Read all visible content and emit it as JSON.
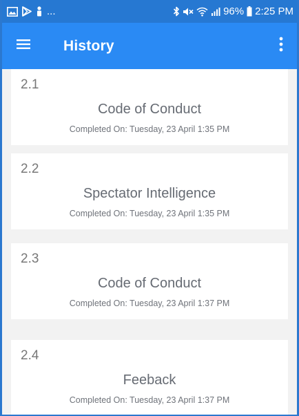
{
  "status_bar": {
    "notification_icons": [
      "image-icon",
      "play-store-icon",
      "person-icon"
    ],
    "more_text": "...",
    "right_icons": [
      "bluetooth-icon",
      "mute-icon",
      "wifi-icon",
      "signal-icon"
    ],
    "battery": "96%",
    "time": "2:25 PM"
  },
  "app_bar": {
    "title": "History",
    "menu_icon": "hamburger-menu-icon",
    "overflow_icon": "more-vertical-icon"
  },
  "history": [
    {
      "number": "2.1",
      "title": "Code of Conduct",
      "completed": "Completed On: Tuesday, 23 April 1:35 PM"
    },
    {
      "number": "2.2",
      "title": "Spectator Intelligence",
      "completed": "Completed On: Tuesday, 23 April 1:35 PM"
    },
    {
      "number": "2.3",
      "title": "Code of Conduct",
      "completed": "Completed On: Tuesday, 23 April 1:37 PM"
    },
    {
      "number": "2.4",
      "title": "Feeback",
      "completed": "Completed On: Tuesday, 23 April 1:37 PM"
    }
  ],
  "colors": {
    "status_bar": "#2678d2",
    "app_bar": "#2a8af4",
    "background": "#f2f2f2",
    "card": "#ffffff",
    "text_secondary": "#6f737a"
  }
}
